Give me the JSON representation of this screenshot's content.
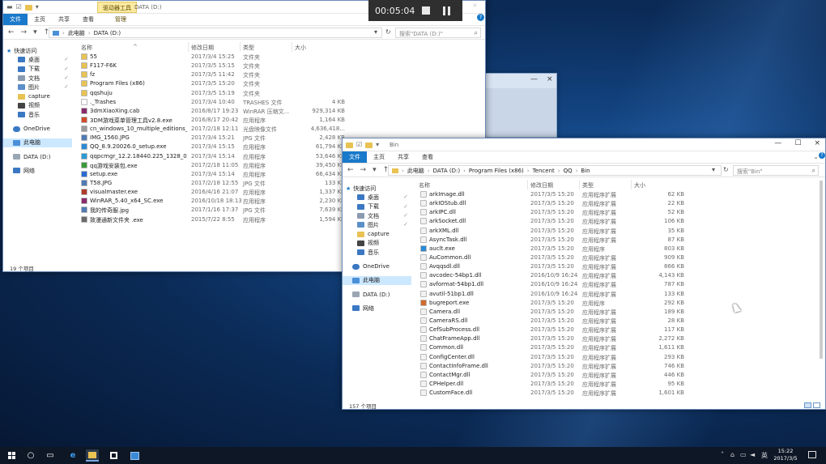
{
  "recorder": {
    "time": "00:05:04",
    "close": "×",
    "help": "?"
  },
  "common_nav": {
    "quick_access": "快速访问",
    "items": [
      {
        "label": "桌面",
        "color": "#3b78c3",
        "pin": true
      },
      {
        "label": "下载",
        "color": "#3b78c3",
        "pin": true
      },
      {
        "label": "文档",
        "color": "#8a9bb0",
        "pin": true
      },
      {
        "label": "图片",
        "color": "#5b8fc8",
        "pin": true
      },
      {
        "label": "capture",
        "color": "#e8c252",
        "pin": false
      },
      {
        "label": "视频",
        "color": "#444444",
        "pin": false
      },
      {
        "label": "音乐",
        "color": "#3b78c3",
        "pin": false
      }
    ],
    "onedrive": "OneDrive",
    "this_pc": "此电脑",
    "drive": "DATA (D:)",
    "network": "网络"
  },
  "win1": {
    "ctx_tab": "驱动器工具",
    "title": "DATA (D:)",
    "tabs": [
      "文件",
      "主页",
      "共享",
      "查看",
      "管理"
    ],
    "address": [
      "此电脑",
      "DATA (D:)"
    ],
    "search_placeholder": "搜索\"DATA (D:)\"",
    "headers": {
      "name": "名称",
      "date": "修改日期",
      "type": "类型",
      "size": "大小"
    },
    "status": "19 个项目",
    "files": [
      {
        "name": "55",
        "date": "2017/3/4 15:25",
        "type": "文件夹",
        "size": "",
        "color": "#e8c252"
      },
      {
        "name": "F117-F6K",
        "date": "2017/3/5 15:15",
        "type": "文件夹",
        "size": "",
        "color": "#e8c252"
      },
      {
        "name": "fz",
        "date": "2017/3/5 11:42",
        "type": "文件夹",
        "size": "",
        "color": "#e8c252"
      },
      {
        "name": "Program Files (x86)",
        "date": "2017/3/5 15:20",
        "type": "文件夹",
        "size": "",
        "color": "#e8c252"
      },
      {
        "name": "qqshuju",
        "date": "2017/3/5 15:19",
        "type": "文件夹",
        "size": "",
        "color": "#e8c252"
      },
      {
        "name": "._Trashes",
        "date": "2017/3/4 10:40",
        "type": "TRASHES 文件",
        "size": "4 KB",
        "color": "#ffffff"
      },
      {
        "name": "3dmXiaoXing.cab",
        "date": "2016/8/17 19:23",
        "type": "WinRAR 压缩文...",
        "size": "929,314 KB",
        "color": "#8b2a6b"
      },
      {
        "name": "3DM游戏菜单管理工具v2.8.exe",
        "date": "2016/8/17 20:42",
        "type": "应用程序",
        "size": "1,164 KB",
        "color": "#d24a2a"
      },
      {
        "name": "cn_windows_10_multiple_editions_ver...",
        "date": "2017/2/18 12:11",
        "type": "光盘映像文件",
        "size": "4,636,418...",
        "color": "#9a9a9a"
      },
      {
        "name": "IMG_1560.JPG",
        "date": "2017/3/4 15:21",
        "type": "JPG 文件",
        "size": "2,428 KB",
        "color": "#4f7bb5"
      },
      {
        "name": "QQ_8.9.20026.0_setup.exe",
        "date": "2017/3/4 15:15",
        "type": "应用程序",
        "size": "61,794 KB",
        "color": "#2a8ad6"
      },
      {
        "name": "qqpcmgr_12.2.18440.225_1328_0.exe",
        "date": "2017/3/4 15:14",
        "type": "应用程序",
        "size": "53,646 KB",
        "color": "#2a9ad6"
      },
      {
        "name": "qq游戏安装包.exe",
        "date": "2017/2/18 11:05",
        "type": "应用程序",
        "size": "39,450 KB",
        "color": "#3a9a3a"
      },
      {
        "name": "setup.exe",
        "date": "2017/3/4 15:14",
        "type": "应用程序",
        "size": "66,434 KB",
        "color": "#2a6ad6"
      },
      {
        "name": "T58.JPG",
        "date": "2017/2/18 12:55",
        "type": "JPG 文件",
        "size": "133 KB",
        "color": "#4f7bb5"
      },
      {
        "name": "visualmaster.exe",
        "date": "2016/4/16 21:07",
        "type": "应用程序",
        "size": "1,337 KB",
        "color": "#b03a2a"
      },
      {
        "name": "WinRAR_5.40_x64_SC.exe",
        "date": "2016/10/18 18:13",
        "type": "应用程序",
        "size": "2,230 KB",
        "color": "#8b2a6b"
      },
      {
        "name": "我的传奇服.jpg",
        "date": "2017/1/16 17:37",
        "type": "JPG 文件",
        "size": "7,639 KB",
        "color": "#4f7bb5"
      },
      {
        "name": "致漫通新文件夹 .exe",
        "date": "2015/7/22 8:55",
        "type": "应用程序",
        "size": "1,594 KB",
        "color": "#6a6a6a"
      }
    ]
  },
  "win2": {
    "title": "Bin",
    "tabs": [
      "文件",
      "主页",
      "共享",
      "查看"
    ],
    "address": [
      "此电脑",
      "DATA (D:)",
      "Program Files (x86)",
      "Tencent",
      "QQ",
      "Bin"
    ],
    "search_placeholder": "搜索\"Bin\"",
    "headers": {
      "name": "名称",
      "date": "修改日期",
      "type": "类型",
      "size": "大小"
    },
    "status": "157 个项目",
    "files": [
      {
        "name": "arkImage.dll",
        "date": "2017/3/5 15:20",
        "type": "应用程序扩展",
        "size": "62 KB",
        "color": "#f2f2f2"
      },
      {
        "name": "arkIOStub.dll",
        "date": "2017/3/5 15:20",
        "type": "应用程序扩展",
        "size": "22 KB",
        "color": "#f2f2f2"
      },
      {
        "name": "arkIPC.dll",
        "date": "2017/3/5 15:20",
        "type": "应用程序扩展",
        "size": "52 KB",
        "color": "#f2f2f2"
      },
      {
        "name": "arkSocket.dll",
        "date": "2017/3/5 15:20",
        "type": "应用程序扩展",
        "size": "106 KB",
        "color": "#f2f2f2"
      },
      {
        "name": "arkXML.dll",
        "date": "2017/3/5 15:20",
        "type": "应用程序扩展",
        "size": "35 KB",
        "color": "#f2f2f2"
      },
      {
        "name": "AsyncTask.dll",
        "date": "2017/3/5 15:20",
        "type": "应用程序扩展",
        "size": "87 KB",
        "color": "#f2f2f2"
      },
      {
        "name": "auclt.exe",
        "date": "2017/3/5 15:20",
        "type": "应用程序",
        "size": "803 KB",
        "color": "#2a8ad6"
      },
      {
        "name": "AuCommon.dll",
        "date": "2017/3/5 15:20",
        "type": "应用程序扩展",
        "size": "909 KB",
        "color": "#f2f2f2"
      },
      {
        "name": "Avqqsdl.dll",
        "date": "2017/3/5 15:20",
        "type": "应用程序扩展",
        "size": "866 KB",
        "color": "#f2f2f2"
      },
      {
        "name": "avcodec-54bp1.dll",
        "date": "2016/10/9 16:24",
        "type": "应用程序扩展",
        "size": "4,143 KB",
        "color": "#f2f2f2"
      },
      {
        "name": "avformat-54bp1.dll",
        "date": "2016/10/9 16:24",
        "type": "应用程序扩展",
        "size": "787 KB",
        "color": "#f2f2f2"
      },
      {
        "name": "avutil-51bp1.dll",
        "date": "2016/10/9 16:24",
        "type": "应用程序扩展",
        "size": "133 KB",
        "color": "#f2f2f2"
      },
      {
        "name": "bugreport.exe",
        "date": "2017/3/5 15:20",
        "type": "应用程序",
        "size": "292 KB",
        "color": "#d26a2a"
      },
      {
        "name": "Camera.dll",
        "date": "2017/3/5 15:20",
        "type": "应用程序扩展",
        "size": "189 KB",
        "color": "#f2f2f2"
      },
      {
        "name": "CameraRS.dll",
        "date": "2017/3/5 15:20",
        "type": "应用程序扩展",
        "size": "28 KB",
        "color": "#f2f2f2"
      },
      {
        "name": "CefSubProcess.dll",
        "date": "2017/3/5 15:20",
        "type": "应用程序扩展",
        "size": "117 KB",
        "color": "#f2f2f2"
      },
      {
        "name": "ChatFrameApp.dll",
        "date": "2017/3/5 15:20",
        "type": "应用程序扩展",
        "size": "2,272 KB",
        "color": "#f2f2f2"
      },
      {
        "name": "Common.dll",
        "date": "2017/3/5 15:20",
        "type": "应用程序扩展",
        "size": "1,611 KB",
        "color": "#f2f2f2"
      },
      {
        "name": "ConfigCenter.dll",
        "date": "2017/3/5 15:20",
        "type": "应用程序扩展",
        "size": "293 KB",
        "color": "#f2f2f2"
      },
      {
        "name": "ContactInfoFrame.dll",
        "date": "2017/3/5 15:20",
        "type": "应用程序扩展",
        "size": "746 KB",
        "color": "#f2f2f2"
      },
      {
        "name": "ContactMgr.dll",
        "date": "2017/3/5 15:20",
        "type": "应用程序扩展",
        "size": "446 KB",
        "color": "#f2f2f2"
      },
      {
        "name": "CPHelper.dll",
        "date": "2017/3/5 15:20",
        "type": "应用程序扩展",
        "size": "95 KB",
        "color": "#f2f2f2"
      },
      {
        "name": "CustomFace.dll",
        "date": "2017/3/5 15:20",
        "type": "应用程序扩展",
        "size": "1,601 KB",
        "color": "#f2f2f2"
      }
    ]
  },
  "taskbar": {
    "tray_text": "英",
    "time": "15:22",
    "date": "2017/3/5"
  }
}
